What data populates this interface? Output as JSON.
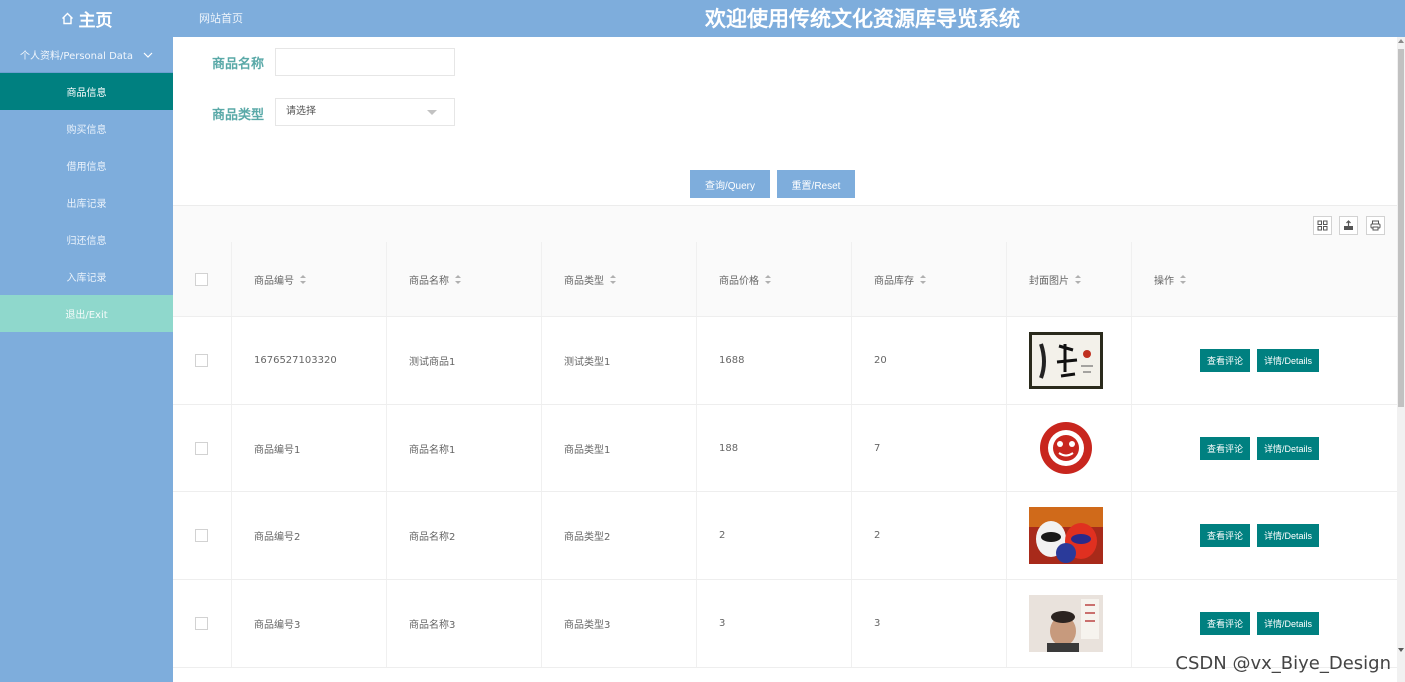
{
  "header": {
    "home_label": "主页",
    "site_link": "网站首页",
    "system_title": "欢迎使用传统文化资源库导览系统"
  },
  "sidebar": {
    "group_label": "个人资料/Personal Data",
    "items": [
      {
        "label": "商品信息",
        "active": true
      },
      {
        "label": "购买信息"
      },
      {
        "label": "借用信息"
      },
      {
        "label": "出库记录"
      },
      {
        "label": "归还信息"
      },
      {
        "label": "入库记录"
      },
      {
        "label": "退出/Exit"
      }
    ]
  },
  "search": {
    "name_label": "商品名称",
    "name_value": "",
    "type_label": "商品类型",
    "type_placeholder": "请选择",
    "query_button": "查询/Query",
    "reset_button": "重置/Reset"
  },
  "table": {
    "columns": [
      "商品编号",
      "商品名称",
      "商品类型",
      "商品价格",
      "商品库存",
      "封面图片",
      "操作"
    ],
    "rows": [
      {
        "code": "1676527103320",
        "name": "测试商品1",
        "type": "测试类型1",
        "price": "1688",
        "stock": "20",
        "image": "calligraphy-painting"
      },
      {
        "code": "商品编号1",
        "name": "商品名称1",
        "type": "商品类型1",
        "price": "188",
        "stock": "7",
        "image": "paper-cut"
      },
      {
        "code": "商品编号2",
        "name": "商品名称2",
        "type": "商品类型2",
        "price": "2",
        "stock": "2",
        "image": "opera-masks"
      },
      {
        "code": "商品编号3",
        "name": "商品名称3",
        "type": "商品类型3",
        "price": "3",
        "stock": "3",
        "image": "portrait-photo"
      }
    ],
    "view_comments_button": "查看评论",
    "details_button": "详情/Details"
  },
  "watermark": "CSDN @vx_Biye_Design",
  "colors": {
    "primary": "#7eaddc",
    "accent_teal": "#008080",
    "exit_item": "#8fd8cc",
    "label_teal": "#5aa9a8"
  }
}
